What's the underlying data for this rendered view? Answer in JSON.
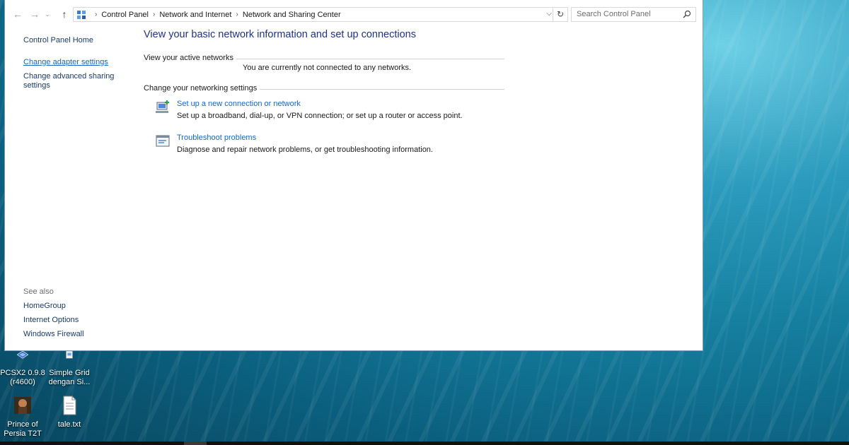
{
  "address_bar": {
    "breadcrumbs": [
      "Control Panel",
      "Network and Internet",
      "Network and Sharing Center"
    ],
    "search_placeholder": "Search Control Panel"
  },
  "left_pane": {
    "home": "Control Panel Home",
    "change_adapter": "Change adapter settings",
    "change_advanced_line1": "Change advanced sharing",
    "change_advanced_line2": "settings",
    "see_also": "See also",
    "see_also_items": [
      "HomeGroup",
      "Internet Options",
      "Windows Firewall"
    ]
  },
  "main": {
    "title": "View your basic network information and set up connections",
    "active_networks_heading": "View your active networks",
    "status_text": "You are currently not connected to any networks.",
    "change_settings_heading": "Change your networking settings",
    "tasks": [
      {
        "link": "Set up a new connection or network",
        "description": "Set up a broadband, dial-up, or VPN connection; or set up a router or access point.",
        "icon": "network-setup-icon"
      },
      {
        "link": "Troubleshoot problems",
        "description": "Diagnose and repair network problems, or get troubleshooting information.",
        "icon": "troubleshoot-icon"
      }
    ]
  },
  "desktop": {
    "icons": [
      {
        "line1": "PCSX2 0.9.8",
        "line2": "(r4600)"
      },
      {
        "line1": "Simple Grid",
        "line2": "dengan Si..."
      },
      {
        "line1": "Prince of",
        "line2": "Persia T2T"
      },
      {
        "line1": "tale.txt",
        "line2": ""
      }
    ]
  },
  "colors": {
    "link_blue": "#1565c8",
    "title_blue": "#1e3287",
    "desktop_teal": "#157e9f"
  }
}
